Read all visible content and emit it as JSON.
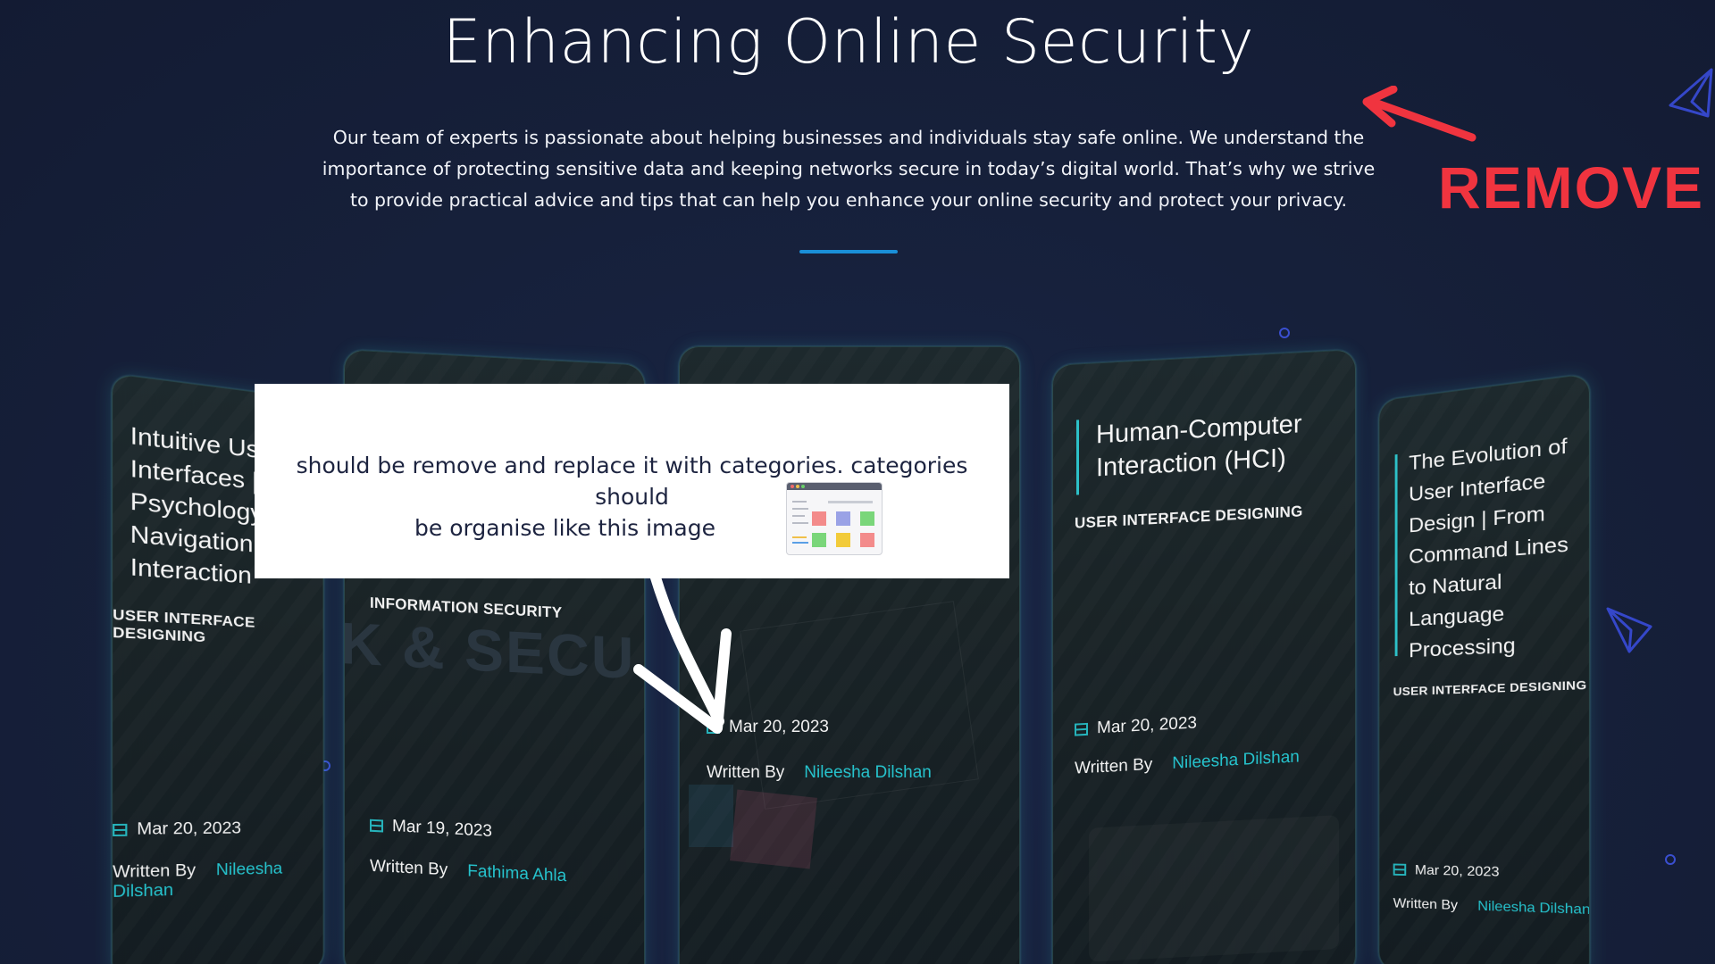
{
  "header": {
    "title": "Enhancing Online Security",
    "intro_line1": "Our team of experts is passionate about helping businesses and individuals stay safe online. We understand the",
    "intro_line2": "importance of protecting sensitive data and keeping networks secure in today’s digital world. That’s why we strive",
    "intro_line3": "to provide practical advice and tips that can help you enhance your online security and protect your privacy."
  },
  "annotations": {
    "remove_label": "REMOVE",
    "overlay_line1": "should be remove and replace it with categories. categories should",
    "overlay_line2": "be organise like this image"
  },
  "cards": [
    {
      "title_lines": [
        "Intuitive User",
        "Interfaces | The",
        "Psychology of",
        "Navigation and",
        "Interaction"
      ],
      "category": "USER INTERFACE DESIGNING",
      "date": "Mar 20, 2023",
      "written_by": "Written By",
      "author": "Nileesha Dilshan"
    },
    {
      "category": "INFORMATION SECURITY",
      "bg_text": "K & SECU",
      "date": "Mar 19, 2023",
      "written_by": "Written By",
      "author": "Fathima Ahla"
    },
    {
      "date": "Mar 20, 2023",
      "written_by": "Written By",
      "author": "Nileesha Dilshan"
    },
    {
      "title_lines": [
        "Human-Computer",
        "Interaction (HCI)"
      ],
      "category": "USER INTERFACE DESIGNING",
      "date": "Mar 20, 2023",
      "written_by": "Written By",
      "author": "Nileesha Dilshan"
    },
    {
      "title_lines": [
        "The Evolution of",
        "User Interface",
        "Design | From",
        "Command Lines",
        "to Natural",
        "Language",
        "Processing"
      ],
      "category": "USER INTERFACE DESIGNING",
      "date": "Mar 20, 2023",
      "written_by": "Written By",
      "author": "Nileesha Dilshan"
    }
  ],
  "colors": {
    "background": "#16203a",
    "accent_blue": "#1a8fd8",
    "teal": "#26c2cc",
    "remove_red": "#f0343f"
  }
}
